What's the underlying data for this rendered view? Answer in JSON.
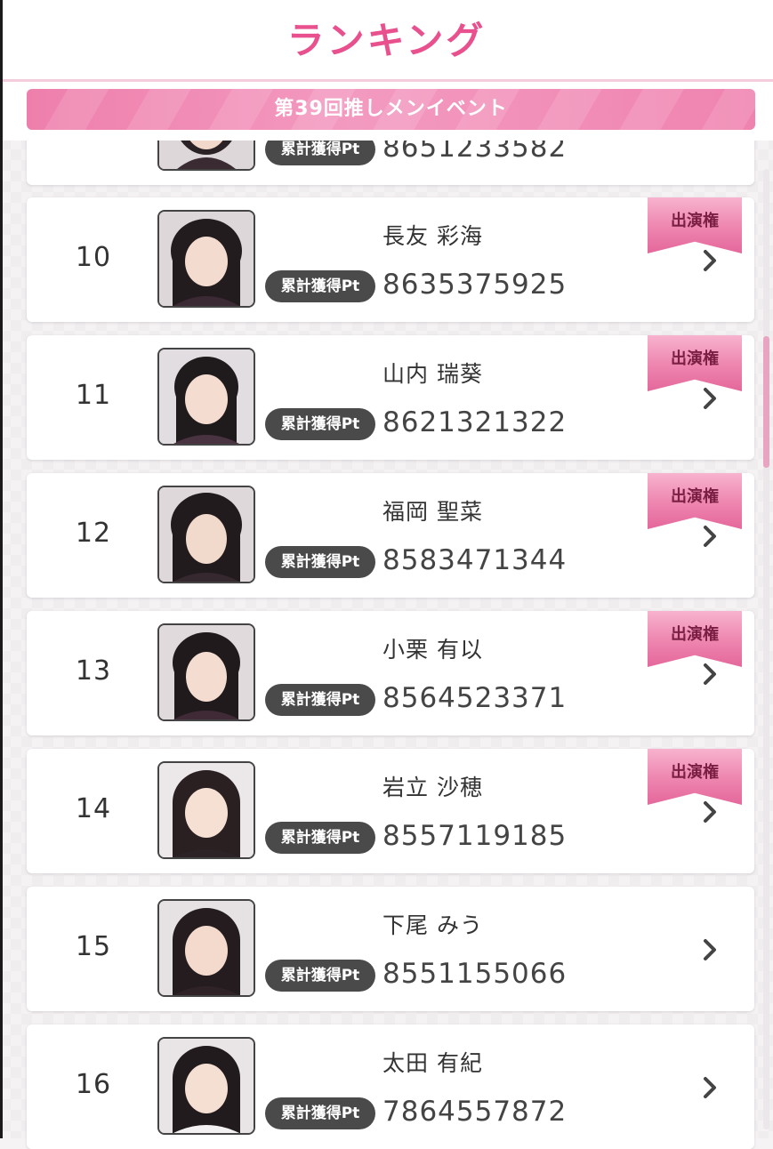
{
  "header": {
    "title": "ランキング"
  },
  "event": {
    "title": "第39回推しメンイベント"
  },
  "labels": {
    "points_badge": "累計獲得Pt",
    "ribbon": "出演権"
  },
  "partial_top": {
    "points": "8651233582"
  },
  "entries": [
    {
      "rank": "10",
      "name": "長友 彩海",
      "points": "8635375925",
      "ribbon": true
    },
    {
      "rank": "11",
      "name": "山内 瑞葵",
      "points": "8621321322",
      "ribbon": true
    },
    {
      "rank": "12",
      "name": "福岡 聖菜",
      "points": "8583471344",
      "ribbon": true
    },
    {
      "rank": "13",
      "name": "小栗 有以",
      "points": "8564523371",
      "ribbon": true
    },
    {
      "rank": "14",
      "name": "岩立 沙穂",
      "points": "8557119185",
      "ribbon": true
    },
    {
      "rank": "15",
      "name": "下尾 みう",
      "points": "8551155066",
      "ribbon": false
    },
    {
      "rank": "16",
      "name": "太田 有紀",
      "points": "7864557872",
      "ribbon": false
    }
  ],
  "icons": {
    "chevron": "chevron-right-icon",
    "avatar": "member-photo"
  },
  "colors": {
    "accent": "#e8508e",
    "ribbon": "#ee86b0",
    "badge": "#4a4a4a"
  }
}
